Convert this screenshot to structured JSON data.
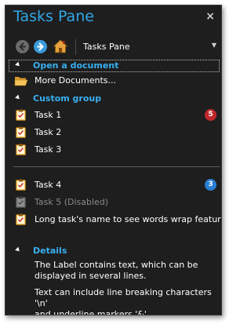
{
  "window": {
    "title": "Tasks Pane",
    "close_glyph": "×"
  },
  "nav": {
    "back_icon": "back-arrow-icon",
    "forward_icon": "forward-arrow-icon",
    "home_icon": "home-icon",
    "current_page": "Tasks Pane",
    "dropdown_icon": "chevron-down-icon"
  },
  "groups": {
    "open_document": {
      "label": "Open a document",
      "items": [
        {
          "label": "More Documents...",
          "icon": "folder-open-icon"
        }
      ]
    },
    "custom": {
      "label": "Custom group",
      "items": [
        {
          "label": "Task 1",
          "icon": "task-clipboard-icon",
          "badge": "5",
          "badge_color": "#c0282d"
        },
        {
          "label": "Task 2",
          "icon": "task-clipboard-icon"
        },
        {
          "label": "Task 3",
          "icon": "task-clipboard-icon"
        },
        {
          "label": "Task 4",
          "icon": "task-clipboard-icon",
          "badge": "3",
          "badge_color": "#2a7fd4"
        },
        {
          "label": "Task 5 (Disabled)",
          "icon": "task-clipboard-icon",
          "disabled": true
        },
        {
          "label": "Long task's name to see words wrap feature",
          "icon": "task-clipboard-icon"
        }
      ]
    },
    "details": {
      "label": "Details",
      "text_line1": "The Label contains text, which can be",
      "text_line2": "displayed in several lines.",
      "text2_line1": "Text can include line breaking characters '\\n'",
      "text2_line2_pre": "and ",
      "text2_line2_ul": "u",
      "text2_line2_post": "nderline markers '&'"
    }
  },
  "colors": {
    "title_accent": "#2fa8e8",
    "group_label": "#38b0f0",
    "pane_background": "#1e1e1e",
    "badge_red": "#c0282d",
    "badge_blue": "#2a7fd4"
  }
}
